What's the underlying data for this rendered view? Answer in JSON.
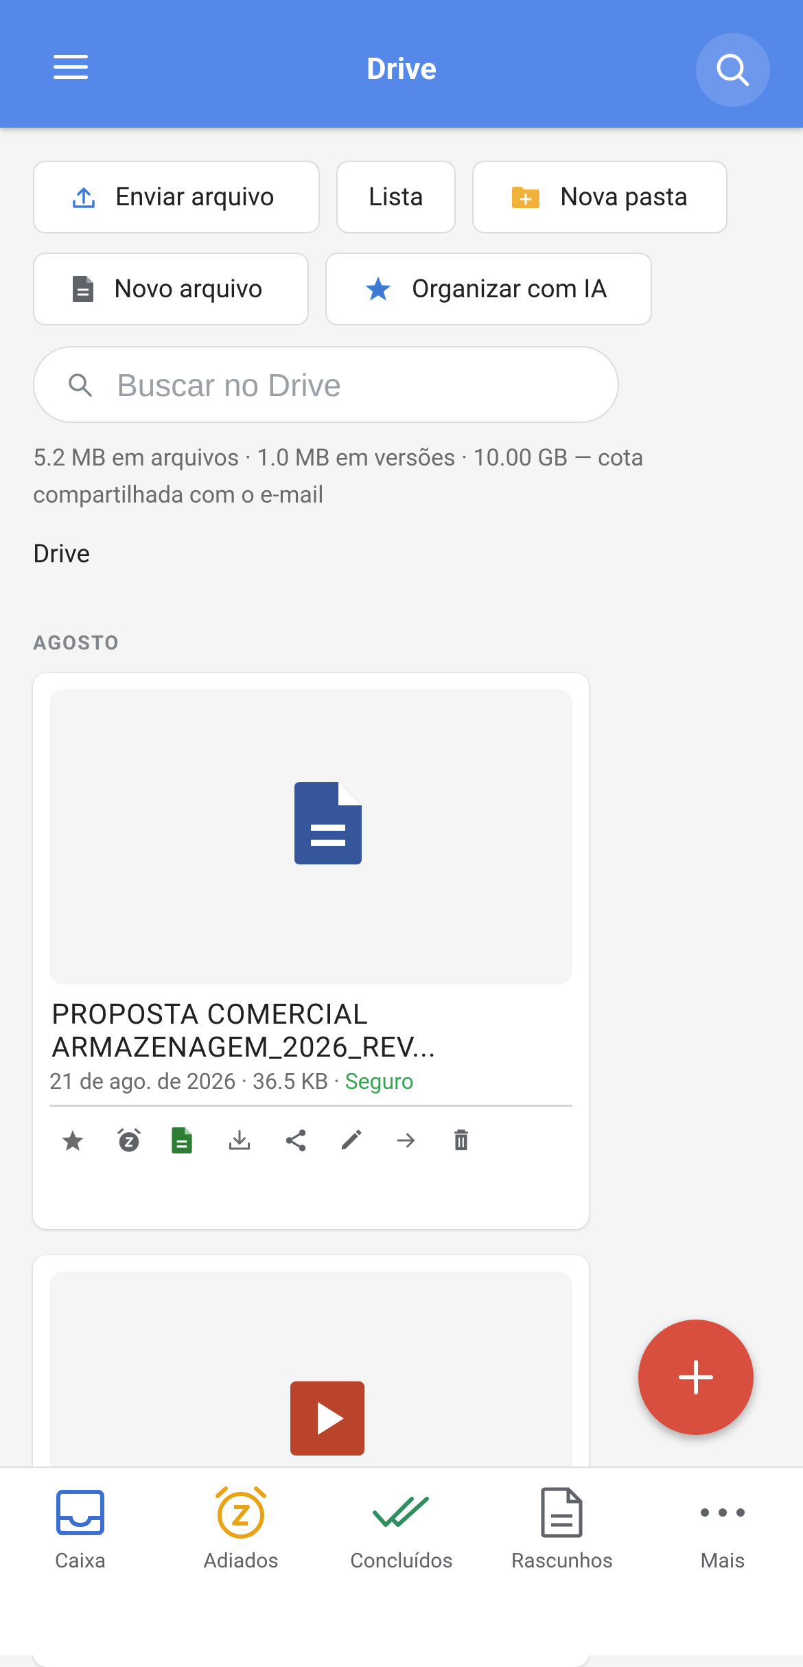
{
  "appbar": {
    "title": "Drive"
  },
  "actions": {
    "upload": "Enviar arquivo",
    "list": "Lista",
    "new_folder": "Nova pasta",
    "new_file": "Novo arquivo",
    "organize_ai": "Organizar com IA"
  },
  "search": {
    "placeholder": "Buscar no Drive"
  },
  "quota": "5.2 MB em arquivos · 1.0 MB em versões · 10.00 GB — cota compartilhada com o e-mail",
  "breadcrumb": "Drive",
  "section_title": "AGOSTO",
  "files": [
    {
      "name": "PROPOSTA COMERCIAL ARMAZENAGEM_2026_REV...",
      "date": "21 de ago. de 2026",
      "size": "36.5 KB",
      "status": "Seguro",
      "icon": "document-icon"
    },
    {
      "icon": "video-icon"
    }
  ],
  "file_actions": [
    "star-icon",
    "snooze-icon",
    "sheet-icon",
    "download-icon",
    "share-icon",
    "edit-icon",
    "move-icon",
    "delete-icon"
  ],
  "fab": {
    "icon": "plus-icon"
  },
  "bottom_nav": [
    {
      "label": "Caixa",
      "icon": "inbox-icon"
    },
    {
      "label": "Adiados",
      "icon": "snooze-clock-icon"
    },
    {
      "label": "Concluídos",
      "icon": "done-all-icon"
    },
    {
      "label": "Rascunhos",
      "icon": "draft-icon"
    },
    {
      "label": "Mais",
      "icon": "more-icon"
    }
  ],
  "colors": {
    "primary": "#5588e8",
    "fab": "#d94f3f",
    "doc_blue": "#35569a",
    "video_red": "#b9442b",
    "safe_green": "#34a853",
    "folder_yellow": "#f2b13a"
  }
}
